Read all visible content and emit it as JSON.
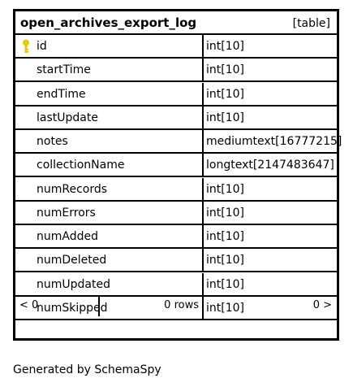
{
  "table": {
    "name": "open_archives_export_log",
    "tag": "[table]",
    "columns": [
      {
        "name": "id",
        "type": "int[10]",
        "primary_key": true
      },
      {
        "name": "startTime",
        "type": "int[10]",
        "primary_key": false
      },
      {
        "name": "endTime",
        "type": "int[10]",
        "primary_key": false
      },
      {
        "name": "lastUpdate",
        "type": "int[10]",
        "primary_key": false
      },
      {
        "name": "notes",
        "type": "mediumtext[16777215]",
        "primary_key": false
      },
      {
        "name": "collectionName",
        "type": "longtext[2147483647]",
        "primary_key": false
      },
      {
        "name": "numRecords",
        "type": "int[10]",
        "primary_key": false
      },
      {
        "name": "numErrors",
        "type": "int[10]",
        "primary_key": false
      },
      {
        "name": "numAdded",
        "type": "int[10]",
        "primary_key": false
      },
      {
        "name": "numDeleted",
        "type": "int[10]",
        "primary_key": false
      },
      {
        "name": "numUpdated",
        "type": "int[10]",
        "primary_key": false
      },
      {
        "name": "numSkipped",
        "type": "int[10]",
        "primary_key": false
      }
    ],
    "footer": {
      "parents": "< 0",
      "rows": "0 rows",
      "children": "0 >"
    }
  },
  "colors": {
    "key_icon": "#e8c800",
    "border": "#000000"
  },
  "generated_by": "Generated by SchemaSpy"
}
